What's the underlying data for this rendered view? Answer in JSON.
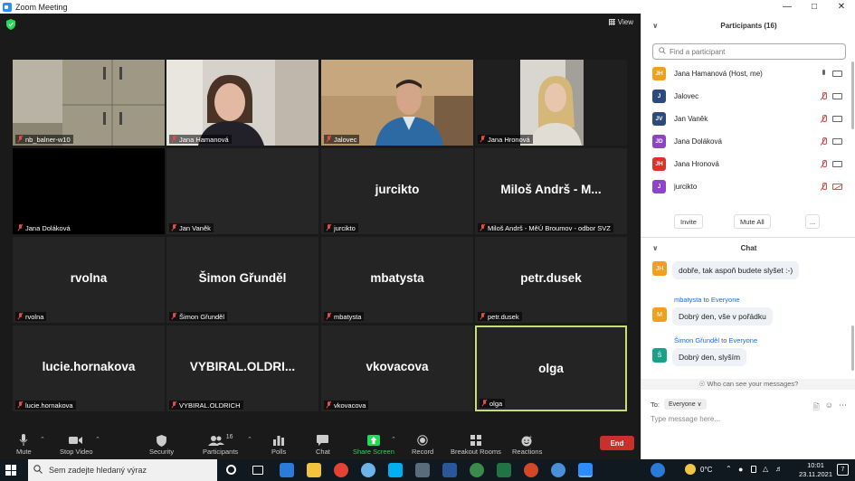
{
  "window": {
    "title": "Zoom Meeting"
  },
  "view_label": "View",
  "tiles": [
    {
      "name": "nb_balner-w10",
      "big": "",
      "video": "cabinet"
    },
    {
      "name": "Jana Hamanová",
      "big": "",
      "video": "woman"
    },
    {
      "name": "Jalovec",
      "big": "",
      "video": "man"
    },
    {
      "name": "Jana Hronová",
      "big": "",
      "video": "blonde"
    },
    {
      "name": "Jana Doláková",
      "big": "",
      "video": "black"
    },
    {
      "name": "Jan Vaněk",
      "big": "",
      "video": "dark"
    },
    {
      "name": "jurcikto",
      "big": "jurcikto",
      "video": ""
    },
    {
      "name": "Miloš Andrš - MěÚ Broumov - odbor SVZ",
      "big": "Miloš Andrš - M...",
      "video": ""
    },
    {
      "name": "rvolna",
      "big": "rvolna",
      "video": ""
    },
    {
      "name": "Šimon Gřunděl",
      "big": "Šimon Gřunděl",
      "video": ""
    },
    {
      "name": "mbatysta",
      "big": "mbatysta",
      "video": ""
    },
    {
      "name": "petr.dusek",
      "big": "petr.dusek",
      "video": ""
    },
    {
      "name": "lucie.hornakova",
      "big": "lucie.hornakova",
      "video": ""
    },
    {
      "name": "VYBIRAL.OLDRICH",
      "big": "VYBIRAL.OLDRI...",
      "video": ""
    },
    {
      "name": "vkovacova",
      "big": "vkovacova",
      "video": ""
    },
    {
      "name": "olga",
      "big": "olga",
      "video": "",
      "active": true
    }
  ],
  "toolbar": {
    "mute": "Mute",
    "stop_video": "Stop Video",
    "security": "Security",
    "participants": "Participants",
    "participants_count": "16",
    "polls": "Polls",
    "chat": "Chat",
    "share_screen": "Share Screen",
    "record": "Record",
    "breakout_rooms": "Breakout Rooms",
    "reactions": "Reactions",
    "end": "End"
  },
  "participants_panel": {
    "title": "Participants (16)",
    "search_placeholder": "Find a participant",
    "list": [
      {
        "initials": "JH",
        "name": "Jana Hamanová (Host, me)",
        "color": "#f0a020",
        "mic": "on",
        "cam": "on"
      },
      {
        "initials": "J",
        "name": "Jalovec",
        "color": "#2d4a7c",
        "mic": "off",
        "cam": "on"
      },
      {
        "initials": "JV",
        "name": "Jan Vaněk",
        "color": "#2d4a7c",
        "mic": "off",
        "cam": "on"
      },
      {
        "initials": "JD",
        "name": "Jana Doláková",
        "color": "#8e44c6",
        "mic": "off",
        "cam": "on"
      },
      {
        "initials": "JH",
        "name": "Jana Hronová",
        "color": "#d9342b",
        "mic": "off",
        "cam": "on"
      },
      {
        "initials": "J",
        "name": "jurcikto",
        "color": "#8e44c6",
        "mic": "off",
        "cam": "off"
      }
    ],
    "invite": "Invite",
    "mute_all": "Mute All",
    "more": "..."
  },
  "chat_panel": {
    "title": "Chat",
    "messages": [
      {
        "from": "",
        "to": "",
        "initials": "JH",
        "color": "#f0a020",
        "text": "dobře, tak aspoň budete slyšet :-)"
      },
      {
        "from": "mbatysta",
        "to": "Everyone",
        "initials": "M",
        "color": "#f0a020",
        "text": "Dobrý den, vše v pořádku"
      },
      {
        "from": "Šimon Gřunděl",
        "to": "Everyone",
        "initials": "Š",
        "color": "#1aa088",
        "text": "Dobrý den, slyším"
      }
    ],
    "to_word": "to",
    "who_can_see": "Who can see your messages?",
    "to_label": "To:",
    "to_value": "Everyone",
    "input_placeholder": "Type message here..."
  },
  "taskbar": {
    "search_placeholder": "Sem zadejte hledaný výraz",
    "temperature": "0°C",
    "time": "10:01",
    "date": "23.11.2021",
    "notification_count": "7"
  }
}
